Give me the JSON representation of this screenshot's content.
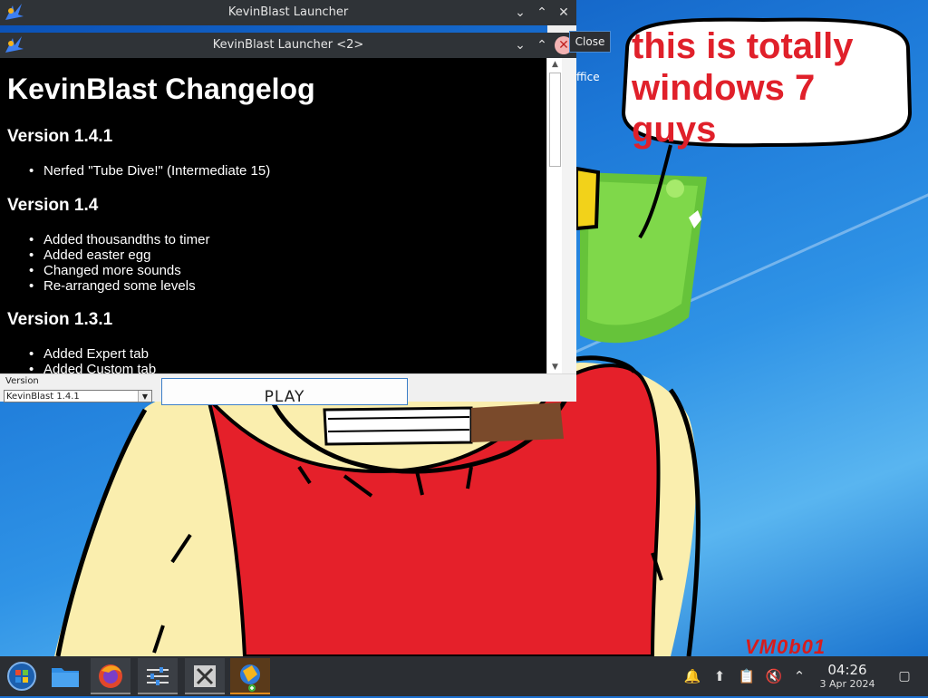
{
  "desktop": {
    "speech_bubble_text": "this is totally windows 7 guys",
    "watermark_text": "VM0b01",
    "peek_text": "ffice",
    "tooltip_text": "Close"
  },
  "back_window": {
    "title": "KevinBlast Launcher"
  },
  "front_window": {
    "title": "KevinBlast Launcher <2>",
    "changelog": {
      "heading": "KevinBlast Changelog",
      "versions": [
        {
          "title": "Version 1.4.1",
          "items": [
            "Nerfed \"Tube Dive!\" (Intermediate 15)"
          ]
        },
        {
          "title": "Version 1.4",
          "items": [
            "Added thousandths to timer",
            "Added easter egg",
            "Changed more sounds",
            "Re-arranged some levels"
          ]
        },
        {
          "title": "Version 1.3.1",
          "items": [
            "Added Expert tab",
            "Added Custom tab"
          ]
        }
      ]
    },
    "version_label": "Version",
    "version_selected": "KevinBlast 1.4.1",
    "play_label": "PLAY"
  },
  "taskbar": {
    "apps": [
      "start-menu",
      "file-manager",
      "firefox",
      "settings",
      "x-app",
      "kevinblast-launcher"
    ],
    "clock_time": "04:26",
    "clock_date": "3 Apr 2024"
  }
}
